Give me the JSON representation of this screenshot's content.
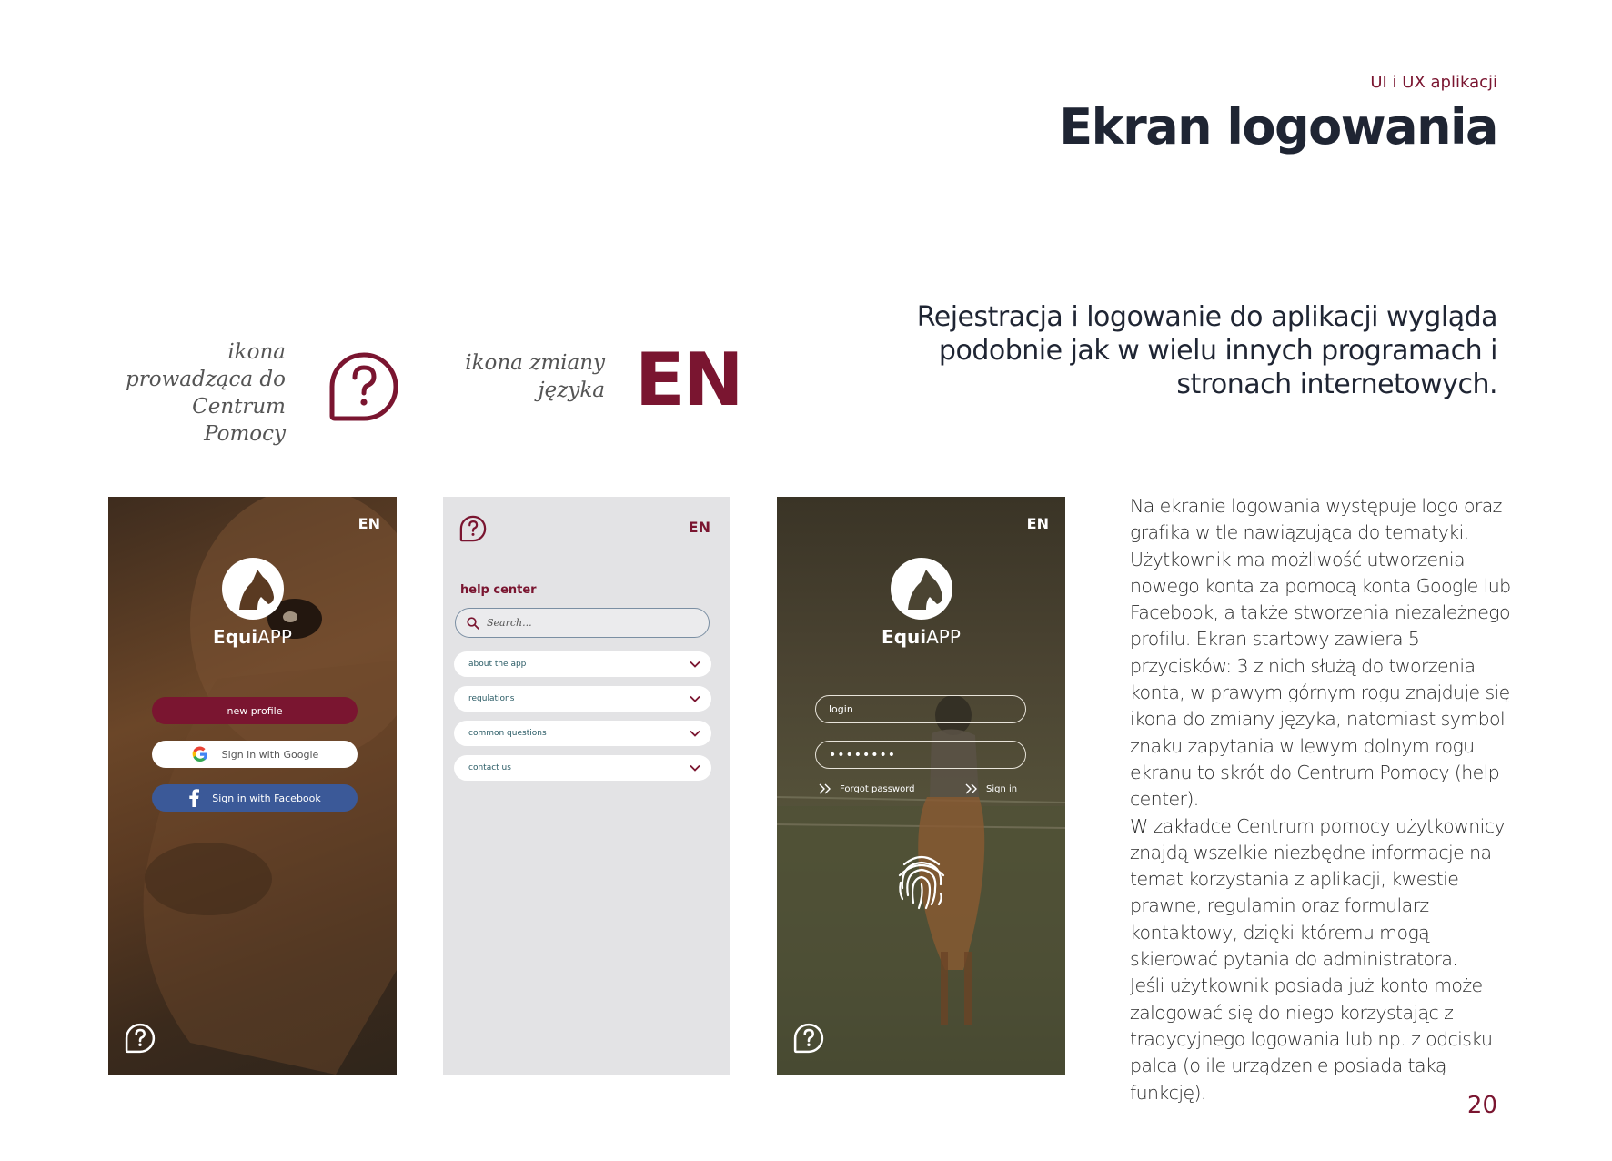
{
  "header": {
    "subtitle": "UI i UX aplikacji",
    "title": "Ekran logowania"
  },
  "lead": "Rejestracja i logowanie do aplikacji wygląda podobnie jak w wielu innych programach i stronach internetowych.",
  "icons_legend": {
    "help_caption": "ikona prowadząca do Centrum Pomocy",
    "lang_caption": "ikona zmiany języka",
    "lang_big": "EN"
  },
  "phone_start": {
    "lang": "EN",
    "logo_bold": "Equi",
    "logo_light": "APP",
    "new_profile": "new profile",
    "google": "Sign in with Google",
    "facebook": "Sign in with Facebook"
  },
  "phone_help": {
    "lang": "EN",
    "title": "help center",
    "search_placeholder": "Search...",
    "items": [
      {
        "label": "about the app"
      },
      {
        "label": "regulations"
      },
      {
        "label": "common questions"
      },
      {
        "label": "contact us"
      }
    ]
  },
  "phone_login": {
    "lang": "EN",
    "logo_bold": "Equi",
    "logo_light": "APP",
    "login_placeholder": "login",
    "password_mask": "••••••••",
    "forgot": "Forgot password",
    "signin": "Sign in"
  },
  "body": {
    "p1": "Na ekranie logowania występuje logo oraz grafika w tle nawiązująca do tematyki. Użytkownik ma możliwość utworzenia nowego konta za pomocą konta Google lub Facebook, a także stworzenia niezależnego profilu. Ekran startowy zawiera 5 przycisków: 3 z nich służą do tworzenia konta, w prawym górnym rogu znajduje się ikona do zmiany języka, natomiast symbol znaku zapytania w lewym dolnym rogu ekranu to skrót do Centrum Pomocy (help center).",
    "p2": "W zakładce Centrum pomocy użytkownicy znajdą wszelkie niezbędne informacje na temat korzystania z aplikacji, kwestie prawne, regulamin oraz formularz kontaktowy, dzięki któremu mogą skierować pytania do administratora.",
    "p3": "Jeśli użytkownik posiada już konto może zalogować się do niego korzystając z tradycyjnego logowania lub np. z odcisku palca (o ile urządzenie posiada taką funkcję)."
  },
  "page_number": "20",
  "colors": {
    "accent": "#7a1530",
    "dark": "#1f2533",
    "facebook": "#3b5998"
  }
}
